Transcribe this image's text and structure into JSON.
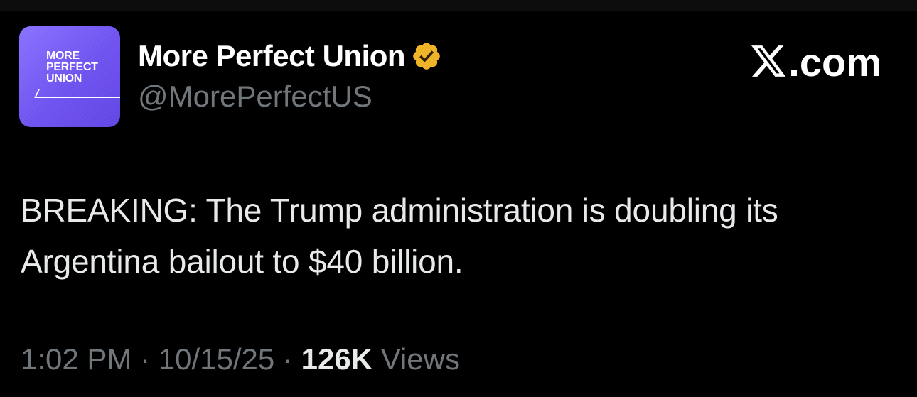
{
  "account": {
    "display_name": "More Perfect Union",
    "handle": "@MorePerfectUS",
    "verified": true,
    "avatar_lines": [
      "MORE",
      "PERFECT",
      "UNION"
    ],
    "avatar_color": "#7a5ff5",
    "verified_color": "#f0b429"
  },
  "brand": {
    "label": ".com",
    "icon": "x-logo-icon"
  },
  "tweet": {
    "text": "BREAKING: The Trump administration is doubling its Argentina bailout to $40 billion."
  },
  "meta": {
    "time": "1:02 PM",
    "separator": "·",
    "date": "10/15/25",
    "views_count": "126K",
    "views_label": "Views"
  }
}
